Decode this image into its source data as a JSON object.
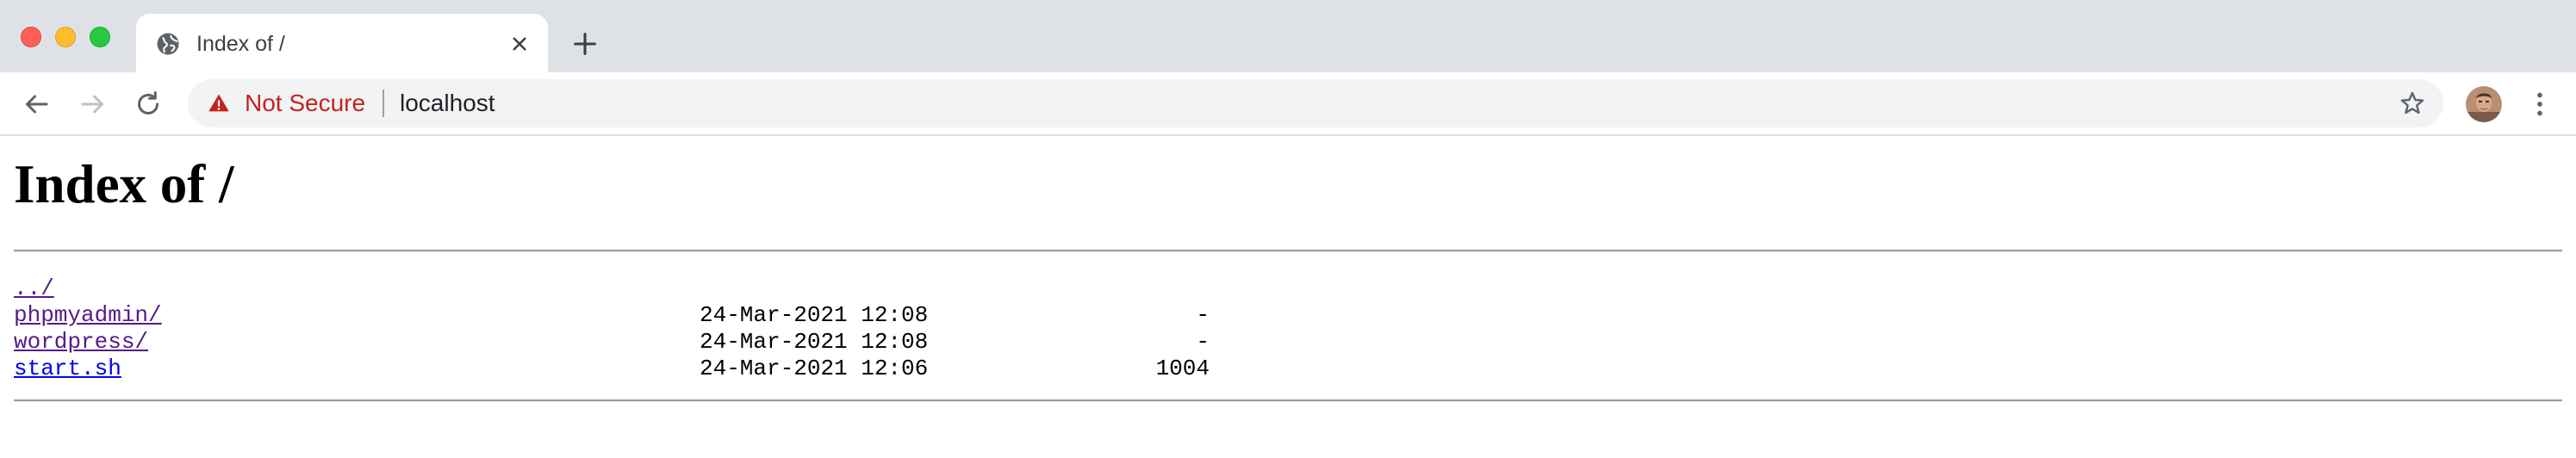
{
  "browser": {
    "tab": {
      "title": "Index of /",
      "favicon": "globe-icon"
    },
    "new_tab_icon": "plus-icon",
    "nav": {
      "back_icon": "arrow-left-icon",
      "forward_icon": "arrow-right-icon",
      "reload_icon": "reload-icon"
    },
    "omnibox": {
      "security_icon": "warning-triangle-icon",
      "security_label": "Not Secure",
      "security_color": "#c5221f",
      "url": "localhost",
      "bookmark_icon": "star-outline-icon"
    },
    "profile_icon": "avatar",
    "menu_icon": "kebab-menu-icon"
  },
  "page": {
    "title": "Index of /",
    "link_color": "#0000ee",
    "visited_link_color": "#551a8b",
    "entries": [
      {
        "name": "../",
        "date": "",
        "size": "",
        "visited": true
      },
      {
        "name": "phpmyadmin/",
        "date": "24-Mar-2021 12:08",
        "size": "-",
        "visited": true
      },
      {
        "name": "wordpress/",
        "date": "24-Mar-2021 12:08",
        "size": "-",
        "visited": true
      },
      {
        "name": "start.sh",
        "date": "24-Mar-2021 12:06",
        "size": "1004",
        "visited": false
      }
    ]
  }
}
